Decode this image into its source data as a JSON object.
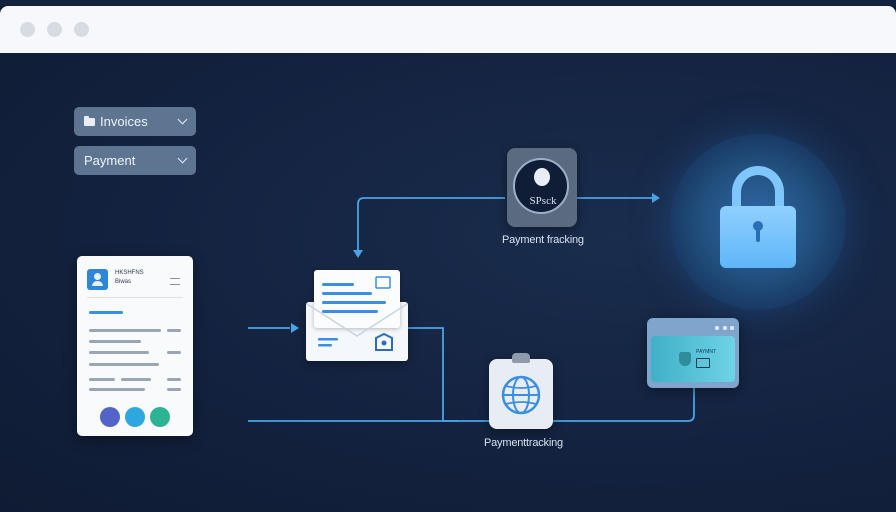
{
  "window": {
    "controls": [
      "window-dot",
      "window-dot",
      "window-dot"
    ]
  },
  "dropdowns": [
    {
      "label": "Invoices",
      "icon": "folder-icon"
    },
    {
      "label": "Payment",
      "icon": ""
    }
  ],
  "invoice_card": {
    "name_line1": "HKSHFNS",
    "name_line2": "Biwas",
    "actions": [
      {
        "icon": "edit-icon",
        "color": "#5364c8"
      },
      {
        "icon": "refresh-icon",
        "color": "#2ea7e0"
      },
      {
        "icon": "pen-icon",
        "color": "#2bb394"
      }
    ]
  },
  "stack_node": {
    "badge_label": "SPsck",
    "caption": "Payment fracking"
  },
  "globe_node": {
    "caption": "Paymenttracking"
  },
  "panel": {
    "text": "PAYMNT"
  },
  "colors": {
    "wire": "#4aa3e8",
    "background": "#0f1d36",
    "lock": "#7fc6fd"
  }
}
